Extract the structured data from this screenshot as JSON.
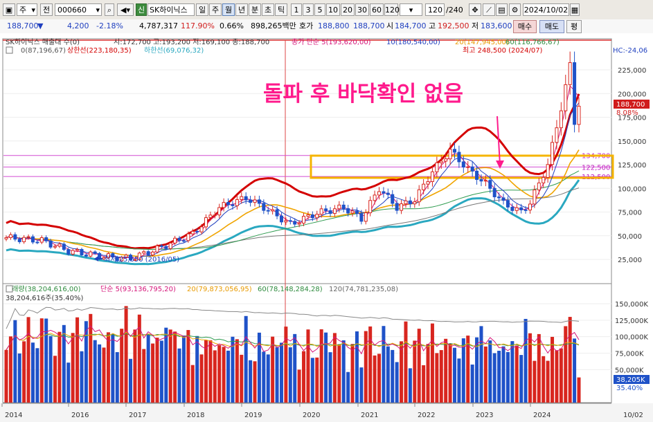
{
  "toolbar": {
    "period_select": "주",
    "prev_label": "전",
    "code_value": "000660",
    "sound_icon": "speaker-icon",
    "credit_badge": "신",
    "stock_name": "SK하이닉스",
    "period_buttons": [
      "일",
      "주",
      "월",
      "년",
      "분",
      "초",
      "틱"
    ],
    "active_period": "월",
    "num_buttons": [
      "1",
      "3",
      "5",
      "10",
      "20",
      "30",
      "60",
      "120"
    ],
    "count_value": "120",
    "count_total": "/240",
    "date_value": "2024/10/02"
  },
  "quote": {
    "price": "188,700",
    "change": "4,200",
    "change_rate": "-2.18%",
    "volume": "4,787,317",
    "volume_rate": "117.90%",
    "turnover": "0.66%",
    "amount": "898,265백만",
    "bid_label": "호가",
    "bid": "188,800",
    "ask": "188,700",
    "open_label": "시",
    "open": "184,700",
    "high_label": "고",
    "high": "192,500",
    "low_label": "저",
    "low": "183,600",
    "buy_button": "매수",
    "sell_button": "매도",
    "eval_button": "평"
  },
  "chart_data": {
    "type": "candlestick",
    "price_legend": {
      "title": "SK하이닉스 매출대 수(0)",
      "ohlc": "시:172,700 고:193,200 저:169,100 종:188,700",
      "ma5": "종가 단순 5(193,620,00)",
      "ma10": "10(180,540,00)",
      "ma20": "20(147,945,00)",
      "ma60": "60(116,766,67)",
      "envelope_mid": "0(87,196,67)",
      "upper": "상한선(223,180,35)",
      "lower": "하한선(69,076,32)",
      "hc": "HC:-24,06"
    },
    "annotation": "돌파 후 바닥확인 없음",
    "max_label": "최고 248,500 (2024/07)",
    "min_label": "최저 25,650 (2016/05)",
    "price_axis": [
      "225,000",
      "200,000",
      "175,000",
      "150,000",
      "125,000",
      "100,000",
      "75,000",
      "50,000",
      "25,000"
    ],
    "current_price_tag": "188,700",
    "current_rate_tag": "8.08%",
    "horizontal_levels": [
      {
        "value": 134700,
        "label": "134,700"
      },
      {
        "value": 122500,
        "label": "122,500"
      },
      {
        "value": 112500,
        "label": "112,500"
      }
    ],
    "volume_legend": {
      "title": "거래량(38,204,616,00)",
      "ma5": "단순 5(93,136,795,20)",
      "ma20": "20(79,873,056,95)",
      "ma60": "60(78,148,284,28)",
      "ma120": "120(74,781,235,08)",
      "current": "38,204,616주(35.40%)"
    },
    "volume_axis": [
      "150,000K",
      "125,000K",
      "100,000K",
      "75,000K",
      "50,000K"
    ],
    "current_volume_tag": "38,205K",
    "current_volume_rate": "35.40%",
    "x_axis": [
      "2014",
      "2016",
      "2017",
      "2018",
      "2019",
      "2020",
      "2021",
      "2022",
      "2023",
      "2024",
      "10/02"
    ],
    "colors": {
      "up": "#d8261f",
      "down": "#1f52c8",
      "upper_band": "#d40000",
      "lower_band": "#2aa8c0",
      "ma20": "#f0a400",
      "ma60": "#2e9b4f",
      "ma120": "#777777",
      "highlight": "#f5b400",
      "annotation": "#ff1a8c"
    }
  }
}
